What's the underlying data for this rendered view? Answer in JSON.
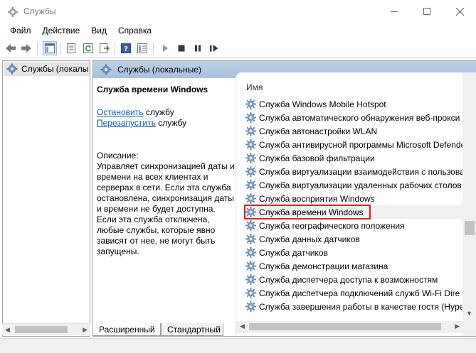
{
  "window": {
    "title": "Службы",
    "icon": "gear-icon"
  },
  "menu": [
    "Файл",
    "Действие",
    "Вид",
    "Справка"
  ],
  "toolbar": {
    "icons": [
      "back-arrow-icon",
      "forward-arrow-icon",
      "console-tree-icon",
      "properties-icon",
      "refresh-icon",
      "export-icon",
      "help-icon",
      "view-icon",
      "play-icon",
      "stop-icon",
      "pause-icon",
      "restart-icon"
    ]
  },
  "tree": {
    "item_label": "Службы (локалы"
  },
  "header": {
    "label": "Службы (локальные)"
  },
  "description": {
    "title": "Служба времени Windows",
    "stop_link": "Остановить",
    "stop_suffix": " службу",
    "restart_link": "Перезапустить",
    "restart_suffix": " службу",
    "label": "Описание:",
    "body": "Управляет синхронизацией даты и времени на всех клиентах и серверах в сети. Если эта служба остановлена, синхронизация даты и времени не будет доступна. Если эта служба отключена, любые службы, которые явно зависят от нее, не могут быть запущены."
  },
  "list": {
    "column_name": "Имя",
    "services": [
      "Служба Windows Mobile Hotspot",
      "Служба автоматического обнаружения веб-прокси",
      "Служба автонастройки WLAN",
      "Служба антивирусной программы Microsoft Defende",
      "Служба базовой фильтрации",
      "Служба виртуализации взаимодействия с пользова",
      "Служба виртуализации удаленных рабочих столов",
      "Служба восприятия Windows",
      "Служба времени Windows",
      "Служба географического положения",
      "Служба данных датчиков",
      "Служба датчиков",
      "Служба демонстрации магазина",
      "Служба диспетчера доступа к возможностям",
      "Служба диспетчера подключений служб Wi-Fi Dire",
      "Служба завершения работы в качестве гостя (Hype"
    ],
    "selected_index": 8,
    "highlight_color": "#e0201a"
  },
  "tabs": [
    "Расширенный",
    "Стандартный"
  ],
  "colors": {
    "header_bg": "#a9c1dc",
    "link": "#0b5fb5"
  }
}
